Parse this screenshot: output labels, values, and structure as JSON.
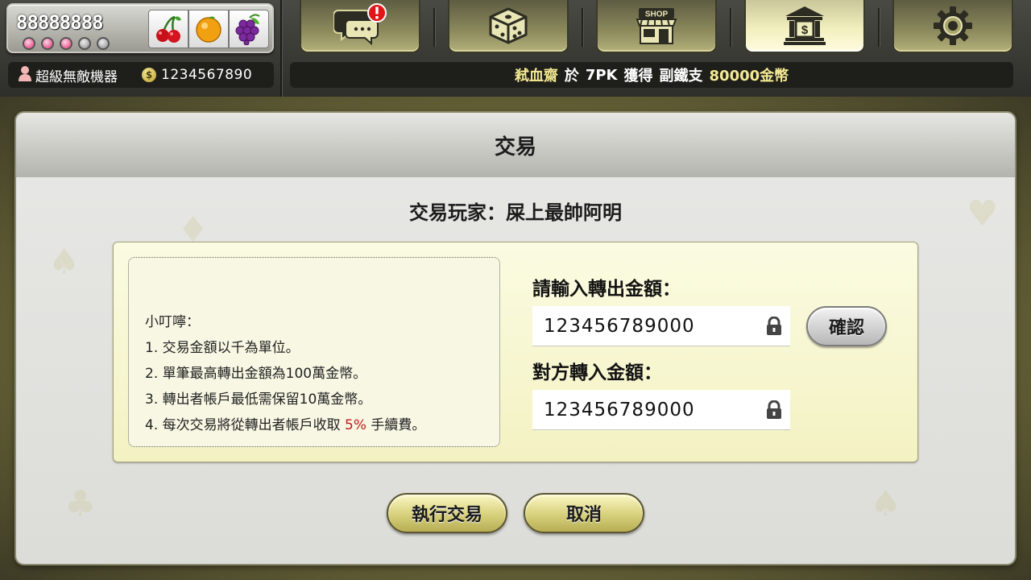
{
  "slot": {
    "score": "88888888",
    "lights": [
      "on",
      "on",
      "on",
      "off",
      "off"
    ],
    "reels": [
      "cherry-icon",
      "orange-icon",
      "grapes-icon"
    ]
  },
  "user": {
    "name": "超級無敵機器",
    "money": "1234567890"
  },
  "nav": {
    "items": [
      {
        "name": "chat",
        "icon": "chat-icon",
        "badge": "!"
      },
      {
        "name": "dice",
        "icon": "dice-icon"
      },
      {
        "name": "shop",
        "icon": "shop-icon",
        "label": "SHOP"
      },
      {
        "name": "bank",
        "icon": "bank-icon",
        "active": true
      },
      {
        "name": "settings",
        "icon": "gear-icon"
      }
    ]
  },
  "ticker": {
    "player": "弒血齋",
    "at": "於",
    "game": "7PK",
    "won": "獲得",
    "hand": "副鐵支",
    "amount": "80000金幣"
  },
  "dialog": {
    "title": "交易",
    "player_label": "交易玩家：屎上最帥阿明",
    "tips": {
      "title": "小叮嚀：",
      "line1": "1. 交易金額以千為單位。",
      "line2": "2. 單筆最高轉出金額為100萬金幣。",
      "line3": "3. 轉出者帳戶最低需保留10萬金幣。",
      "line4_pre": "4. 每次交易將從轉出者帳戶收取 ",
      "line4_fee": "5%",
      "line4_post": " 手續費。"
    },
    "transfer_out_label": "請輸入轉出金額：",
    "transfer_out_value": "123456789000",
    "confirm_label": "確認",
    "transfer_in_label": "對方轉入金額：",
    "transfer_in_value": "123456789000",
    "execute_label": "執行交易",
    "cancel_label": "取消"
  }
}
